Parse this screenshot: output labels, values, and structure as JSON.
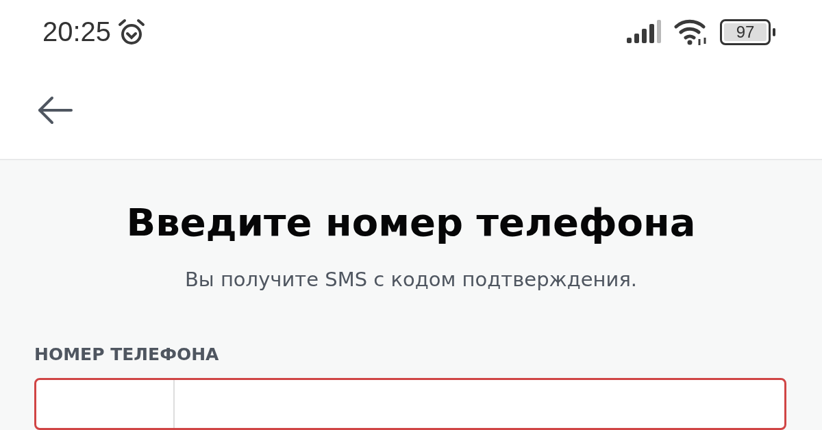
{
  "status_bar": {
    "time": "20:25",
    "battery": "97"
  },
  "title": "Введите номер телефона",
  "subtitle": "Вы получите SMS с кодом подтверждения.",
  "phone_field": {
    "label": "НОМЕР ТЕЛЕФОНА",
    "invalid": true
  }
}
